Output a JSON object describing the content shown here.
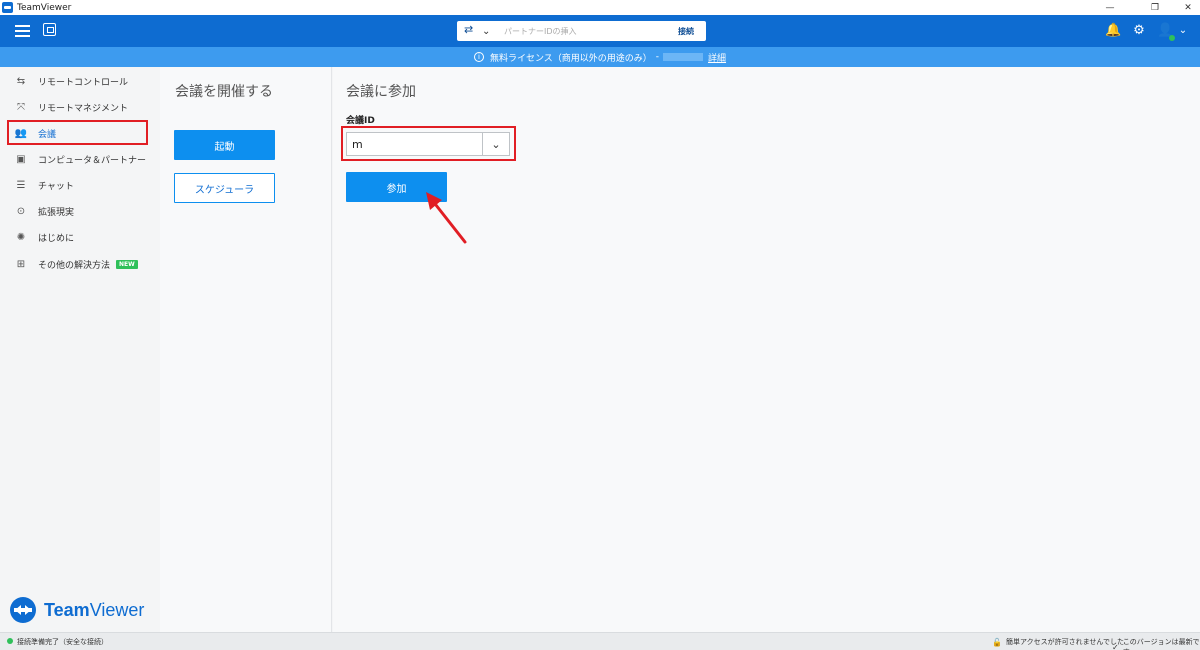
{
  "window": {
    "title": "TeamViewer",
    "controls": {
      "minimize": "—",
      "restore": "❐",
      "close": "✕"
    }
  },
  "topbar": {
    "partner_placeholder": "パートナーIDの挿入",
    "connect_label": "接続",
    "chevron": "⌄",
    "bell": "🔔",
    "gear": "⚙",
    "user": "👤",
    "user_chevron": "⌄"
  },
  "license_bar": {
    "info": "i",
    "text": "無料ライセンス（商用以外の用途のみ）",
    "dash": "-",
    "details_link": "詳細"
  },
  "sidebar": {
    "items": [
      {
        "label": "リモートコントロール",
        "icon": "⇆"
      },
      {
        "label": "リモートマネジメント",
        "icon": "⤧"
      },
      {
        "label": "会議",
        "icon": "👥"
      },
      {
        "label": "コンピュータ＆パートナー",
        "icon": "▣"
      },
      {
        "label": "チャット",
        "icon": "☰"
      },
      {
        "label": "拡張現実",
        "icon": "⊙"
      },
      {
        "label": "はじめに",
        "icon": "✺"
      },
      {
        "label": "その他の解決方法",
        "icon": "⊞",
        "badge": "NEW"
      }
    ],
    "brand": {
      "team": "Team",
      "viewer": "Viewer"
    }
  },
  "host": {
    "title": "会議を開催する",
    "start_label": "起動",
    "schedule_label": "スケジューラ"
  },
  "join": {
    "title": "会議に参加",
    "id_label": "会議ID",
    "id_value": "m",
    "dropdown": "⌄",
    "join_label": "参加"
  },
  "statusbar": {
    "connection": "接続準備完了（安全な接続）",
    "easy_access": "簡単アクセスが許可されませんでした",
    "version": "このバージョンは最新です",
    "lock": "🔓",
    "check": "✓"
  },
  "colors": {
    "brand_blue": "#0e6cd1",
    "button_blue": "#0d8fef",
    "license_blue": "#3d9bef",
    "highlight_red": "#e11e24",
    "status_green": "#2fc05a"
  }
}
